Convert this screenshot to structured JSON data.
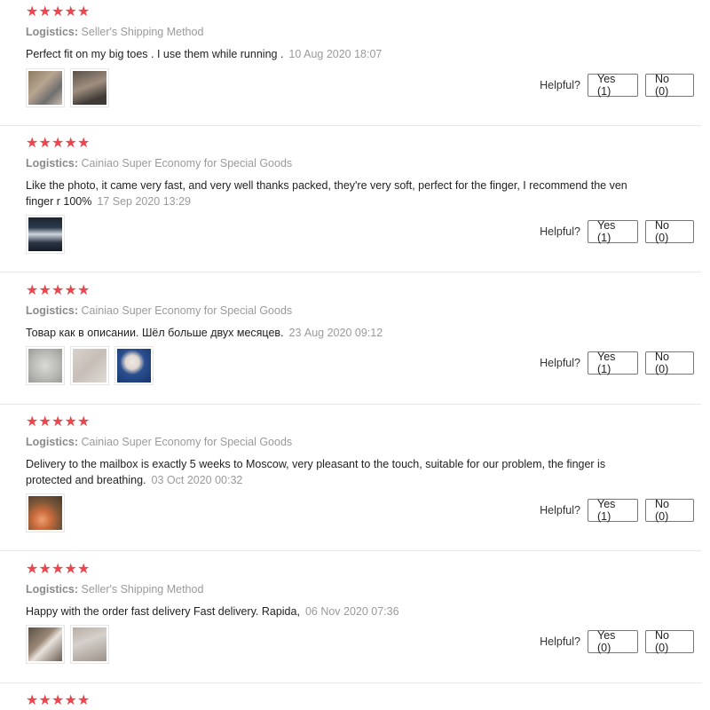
{
  "helpful_label": "Helpful?",
  "logistics_label": "Logistics:",
  "star_glyph": "★",
  "reviews": [
    {
      "rating": 5,
      "logistics": "Seller's Shipping Method",
      "text": "Perfect fit on my big toes . I use them while running .",
      "date": "10 Aug 2020 18:07",
      "yes": "Yes (1)",
      "no": "No (0)",
      "images": [
        "toe-photo-1",
        "toe-photo-2"
      ]
    },
    {
      "rating": 5,
      "logistics": "Cainiao Super Economy for Special Goods",
      "text": "Like the photo, it came very fast, and very well thanks packed, they're very soft, perfect for the finger, I recommend the ven finger r 100%",
      "date": "17 Sep 2020 13:29",
      "yes": "Yes (1)",
      "no": "No (0)",
      "images": [
        "package-photo"
      ]
    },
    {
      "rating": 5,
      "logistics": "Cainiao Super Economy for Special Goods",
      "text": "Товар как в описании. Шёл больше двух месяцев.",
      "date": "23 Aug 2020 09:12",
      "yes": "Yes (1)",
      "no": "No (0)",
      "images": [
        "packet-photo",
        "product-photo",
        "foot-photo"
      ]
    },
    {
      "rating": 5,
      "logistics": "Cainiao Super Economy for Special Goods",
      "text": "Delivery to the mailbox is exactly 5 weeks to Moscow, very pleasant to the touch, suitable for our problem, the finger is protected and breathing.",
      "date": "03 Oct 2020 00:32",
      "yes": "Yes (1)",
      "no": "No (0)",
      "images": [
        "toe-photo"
      ]
    },
    {
      "rating": 5,
      "logistics": "Seller's Shipping Method",
      "text": "Happy with the order fast delivery Fast delivery. Rapida,",
      "date": "06 Nov 2020 07:36",
      "yes": "Yes (0)",
      "no": "No (0)",
      "images": [
        "toe-photo",
        "package-photo"
      ]
    },
    {
      "rating": 5
    }
  ]
}
